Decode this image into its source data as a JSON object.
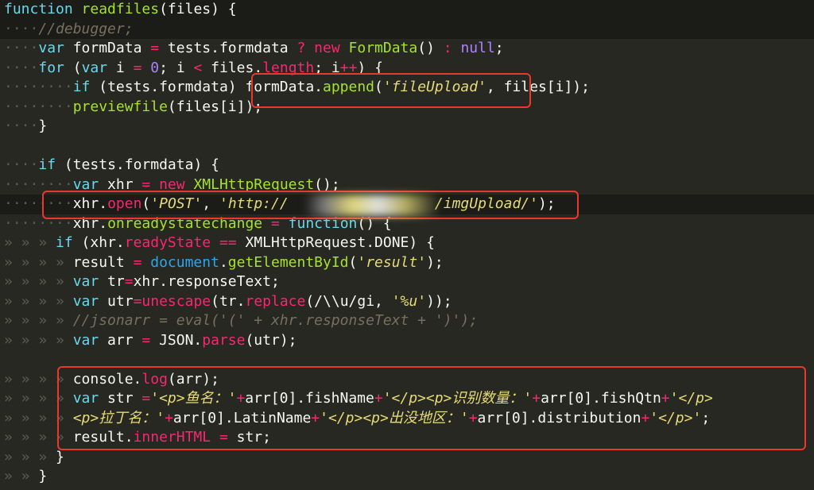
{
  "editor": {
    "lines": [
      [
        [
          "t-kw",
          "function"
        ],
        [
          "t-pl",
          " "
        ],
        [
          "t-fn",
          "readfiles"
        ],
        [
          "t-pl",
          "(files) {"
        ]
      ],
      [
        [
          "ind",
          "····"
        ],
        [
          "t-cm",
          "//debugger;"
        ]
      ],
      [
        [
          "ind",
          "····"
        ],
        [
          "t-kw",
          "var"
        ],
        [
          "t-pl",
          " formData "
        ],
        [
          "t-op",
          "="
        ],
        [
          "t-pl",
          " tests.formdata "
        ],
        [
          "t-op",
          "?"
        ],
        [
          "t-pl",
          " "
        ],
        [
          "t-op",
          "new"
        ],
        [
          "t-pl",
          " "
        ],
        [
          "t-fn",
          "FormData"
        ],
        [
          "t-pl",
          "() "
        ],
        [
          "t-op",
          ":"
        ],
        [
          "t-pl",
          " "
        ],
        [
          "t-num",
          "null"
        ],
        [
          "t-pl",
          ";"
        ]
      ],
      [
        [
          "ind",
          "····"
        ],
        [
          "t-kw",
          "for"
        ],
        [
          "t-pl",
          " ("
        ],
        [
          "t-kw",
          "var"
        ],
        [
          "t-pl",
          " i "
        ],
        [
          "t-op",
          "="
        ],
        [
          "t-pl",
          " "
        ],
        [
          "t-num",
          "0"
        ],
        [
          "t-pl",
          "; i "
        ],
        [
          "t-op",
          "<"
        ],
        [
          "t-pl",
          " files."
        ],
        [
          "t-prop2",
          "length"
        ],
        [
          "t-pl",
          "; i"
        ],
        [
          "t-op",
          "++"
        ],
        [
          "t-pl",
          ") {"
        ]
      ],
      [
        [
          "ind",
          "········"
        ],
        [
          "t-kw",
          "if"
        ],
        [
          "t-pl",
          " (tests.formdata) formData."
        ],
        [
          "t-fn",
          "append"
        ],
        [
          "t-pl",
          "("
        ],
        [
          "t-str",
          "'fileUpload'"
        ],
        [
          "t-pl",
          ", files[i]);"
        ]
      ],
      [
        [
          "ind",
          "········"
        ],
        [
          "t-fn",
          "previewfile"
        ],
        [
          "t-pl",
          "(files[i]);"
        ]
      ],
      [
        [
          "ind",
          "····"
        ],
        [
          "t-pl",
          "}"
        ]
      ],
      [
        [
          "t-pl",
          ""
        ]
      ],
      [
        [
          "ind",
          "····"
        ],
        [
          "t-kw",
          "if"
        ],
        [
          "t-pl",
          " (tests.formdata) {"
        ]
      ],
      [
        [
          "ind",
          "········"
        ],
        [
          "t-kw",
          "var"
        ],
        [
          "t-pl",
          " xhr "
        ],
        [
          "t-op",
          "="
        ],
        [
          "t-pl",
          " "
        ],
        [
          "t-op",
          "new"
        ],
        [
          "t-pl",
          " "
        ],
        [
          "t-fn",
          "XMLHttpRequest"
        ],
        [
          "t-pl",
          "();"
        ]
      ],
      [
        [
          "ind",
          "········"
        ],
        [
          "t-pl",
          "xhr."
        ],
        [
          "t-prop2",
          "open"
        ],
        [
          "t-pl",
          "("
        ],
        [
          "t-str",
          "'POST'"
        ],
        [
          "t-pl",
          ", "
        ],
        [
          "t-str",
          "'http://                 /imgUpload/'"
        ],
        [
          "t-pl",
          ");"
        ]
      ],
      [
        [
          "ind",
          "········"
        ],
        [
          "t-pl",
          "xhr."
        ],
        [
          "t-fn",
          "onreadystatechange"
        ],
        [
          "t-pl",
          " "
        ],
        [
          "t-op",
          "="
        ],
        [
          "t-pl",
          " "
        ],
        [
          "t-kw",
          "function"
        ],
        [
          "t-pl",
          "() {"
        ]
      ],
      [
        [
          "ind",
          "» » » "
        ],
        [
          "t-kw",
          "if"
        ],
        [
          "t-pl",
          " (xhr."
        ],
        [
          "t-prop2",
          "readyState"
        ],
        [
          "t-pl",
          " "
        ],
        [
          "t-op",
          "=="
        ],
        [
          "t-pl",
          " XMLHttpRequest.DONE) {"
        ]
      ],
      [
        [
          "ind",
          "» » » » "
        ],
        [
          "t-pl",
          "result "
        ],
        [
          "t-op",
          "="
        ],
        [
          "t-pl",
          " "
        ],
        [
          "t-dom",
          "document"
        ],
        [
          "t-pl",
          "."
        ],
        [
          "t-fn",
          "getElementById"
        ],
        [
          "t-pl",
          "("
        ],
        [
          "t-str",
          "'result'"
        ],
        [
          "t-pl",
          ");"
        ]
      ],
      [
        [
          "ind",
          "» » » » "
        ],
        [
          "t-kw",
          "var"
        ],
        [
          "t-pl",
          " tr"
        ],
        [
          "t-op",
          "="
        ],
        [
          "t-pl",
          "xhr.responseText;"
        ]
      ],
      [
        [
          "ind",
          "» » » » "
        ],
        [
          "t-kw",
          "var"
        ],
        [
          "t-pl",
          " utr"
        ],
        [
          "t-op",
          "="
        ],
        [
          "t-prop2",
          "unescape"
        ],
        [
          "t-pl",
          "(tr."
        ],
        [
          "t-prop2",
          "replace"
        ],
        [
          "t-pl",
          "(/\\\\u/gi, "
        ],
        [
          "t-str",
          "'%u'"
        ],
        [
          "t-pl",
          "));"
        ]
      ],
      [
        [
          "ind",
          "» » » » "
        ],
        [
          "t-cm",
          "//jsonarr = eval('(' + xhr.responseText + ')');"
        ]
      ],
      [
        [
          "ind",
          "» » » » "
        ],
        [
          "t-kw",
          "var"
        ],
        [
          "t-pl",
          " arr "
        ],
        [
          "t-op",
          "="
        ],
        [
          "t-pl",
          " JSON."
        ],
        [
          "t-prop2",
          "parse"
        ],
        [
          "t-pl",
          "(utr);"
        ]
      ],
      [
        [
          "t-pl",
          ""
        ]
      ],
      [
        [
          "ind",
          "» » » » "
        ],
        [
          "t-pl",
          "console."
        ],
        [
          "t-prop2",
          "log"
        ],
        [
          "t-pl",
          "(arr);"
        ]
      ],
      [
        [
          "ind",
          "» » » » "
        ],
        [
          "t-kw",
          "var"
        ],
        [
          "t-pl",
          " str "
        ],
        [
          "t-op",
          "="
        ],
        [
          "t-str",
          "'<p>鱼名：'"
        ],
        [
          "t-op",
          "+"
        ],
        [
          "t-pl",
          "arr[0].fishName"
        ],
        [
          "t-op",
          "+"
        ],
        [
          "t-str",
          "'</p><p>识别数量：'"
        ],
        [
          "t-op",
          "+"
        ],
        [
          "t-pl",
          "arr[0].fishQtn"
        ],
        [
          "t-op",
          "+"
        ],
        [
          "t-str",
          "'</p>"
        ]
      ],
      [
        [
          "ind",
          "» » » » "
        ],
        [
          "t-str",
          "<p>拉丁名：'"
        ],
        [
          "t-op",
          "+"
        ],
        [
          "t-pl",
          "arr[0].LatinName"
        ],
        [
          "t-op",
          "+"
        ],
        [
          "t-str",
          "'</p><p>出没地区：'"
        ],
        [
          "t-op",
          "+"
        ],
        [
          "t-pl",
          "arr[0].distribution"
        ],
        [
          "t-op",
          "+"
        ],
        [
          "t-str",
          "'</p>'"
        ],
        [
          "t-pl",
          ";"
        ]
      ],
      [
        [
          "ind",
          "» » » » "
        ],
        [
          "t-pl",
          "result."
        ],
        [
          "t-prop2",
          "innerHTML"
        ],
        [
          "t-pl",
          " "
        ],
        [
          "t-op",
          "="
        ],
        [
          "t-pl",
          " str;"
        ]
      ],
      [
        [
          "ind",
          "» » » "
        ],
        [
          "t-pl",
          "}"
        ]
      ],
      [
        [
          "ind",
          "» » "
        ],
        [
          "t-pl",
          "}"
        ]
      ]
    ]
  },
  "colors": {
    "background": "#272822",
    "highlight_border": "#e8392e"
  }
}
